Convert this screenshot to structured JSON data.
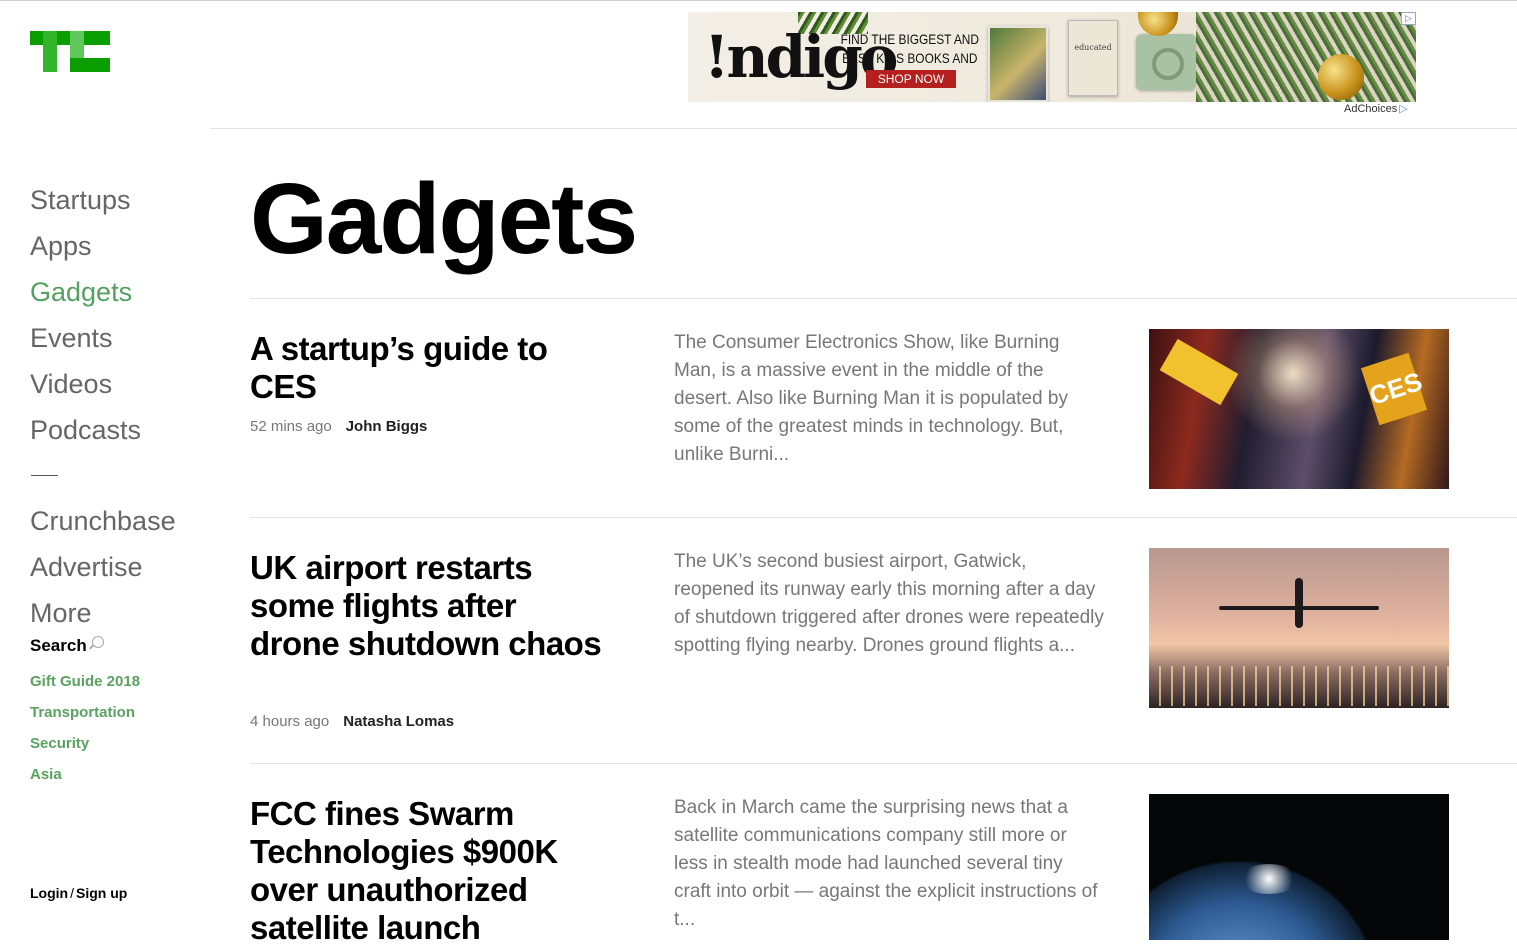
{
  "logo": {
    "alt": "TC",
    "color": "#0a9e01"
  },
  "ad": {
    "brand": "!ndigo",
    "tagline_1": "FIND THE BIGGEST AND",
    "tagline_2": "BEST KIDS BOOKS AND TOYS",
    "cta": "SHOP NOW",
    "book_title": "educated",
    "close_icon": "ad-info-icon",
    "adchoices": "AdChoices"
  },
  "nav": {
    "items": [
      {
        "label": "Startups",
        "active": false
      },
      {
        "label": "Apps",
        "active": false
      },
      {
        "label": "Gadgets",
        "active": true
      },
      {
        "label": "Events",
        "active": false
      },
      {
        "label": "Videos",
        "active": false
      },
      {
        "label": "Podcasts",
        "active": false
      }
    ],
    "secondary": [
      {
        "label": "Crunchbase"
      },
      {
        "label": "Advertise"
      },
      {
        "label": "More"
      }
    ],
    "search_label": "Search",
    "sub_items": [
      {
        "label": "Gift Guide 2018"
      },
      {
        "label": "Transportation"
      },
      {
        "label": "Security"
      },
      {
        "label": "Asia"
      }
    ],
    "login": "Login",
    "login_sep": "/",
    "signup": "Sign up",
    "accent_color": "#53a160"
  },
  "page": {
    "title": "Gadgets"
  },
  "articles": [
    {
      "title": "A startup’s guide to CES",
      "time": "52 mins ago",
      "author": "John Biggs",
      "excerpt": "The Consumer Electronics Show, like Burning Man, is a massive event in the middle of the desert. Also like Burning Man it is populated by some of the greatest minds in technology. But, unlike Burni...",
      "image_sign": "CES"
    },
    {
      "title": "UK airport restarts some flights after drone shutdown chaos",
      "time": "4 hours ago",
      "author": "Natasha Lomas",
      "excerpt": "The UK’s second busiest airport, Gatwick, reopened its runway early this morning after a day of shutdown triggered after drones were repeatedly spotting flying nearby. Drones ground flights a..."
    },
    {
      "title": "FCC fines Swarm Technologies $900K over unauthorized satellite launch",
      "excerpt": "Back in March came the surprising news that a satellite communications company still more or less in stealth mode had launched several tiny craft into orbit — against the explicit instructions of t..."
    }
  ]
}
